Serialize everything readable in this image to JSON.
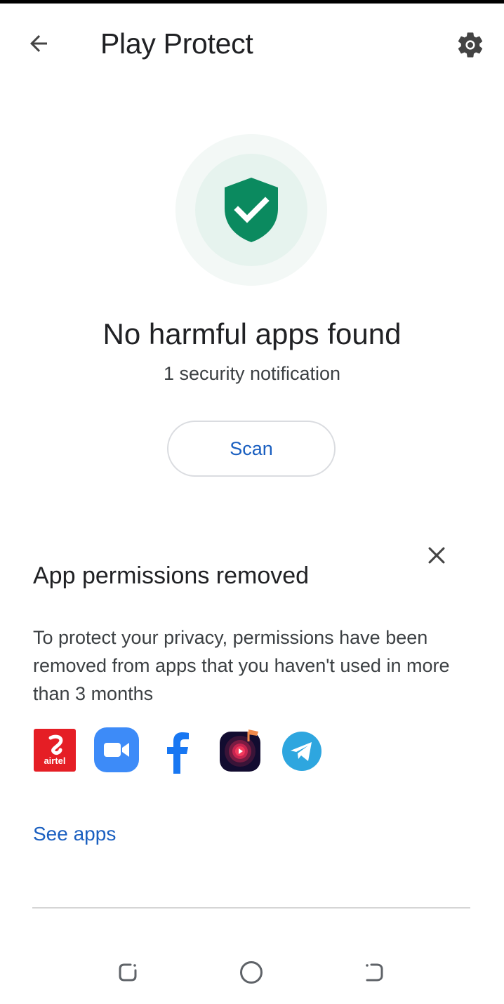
{
  "app_bar": {
    "title": "Play Protect",
    "back_icon": "arrow-back-icon",
    "settings_icon": "gear-icon"
  },
  "status": {
    "icon": "shield-check-icon",
    "title": "No harmful apps found",
    "subtitle": "1 security notification",
    "scan_label": "Scan"
  },
  "card": {
    "title": "App permissions removed",
    "body": "To protect your privacy, permissions have been removed from apps that you haven't used in more than 3 months",
    "close_icon": "close-icon",
    "apps": [
      {
        "name": "Airtel",
        "icon": "airtel-app-icon",
        "label": "airtel"
      },
      {
        "name": "Zoom",
        "icon": "zoom-app-icon"
      },
      {
        "name": "Facebook",
        "icon": "facebook-app-icon"
      },
      {
        "name": "Music player",
        "icon": "music-player-app-icon"
      },
      {
        "name": "Telegram",
        "icon": "telegram-app-icon"
      }
    ],
    "link_label": "See apps"
  },
  "nav_bar": {
    "recents_icon": "recents-icon",
    "home_icon": "home-icon",
    "back_icon": "nav-back-icon"
  },
  "colors": {
    "accent_blue": "#1a5fc0",
    "shield_green": "#0b8a5f",
    "text_primary": "#202124",
    "text_secondary": "#3c4043"
  }
}
